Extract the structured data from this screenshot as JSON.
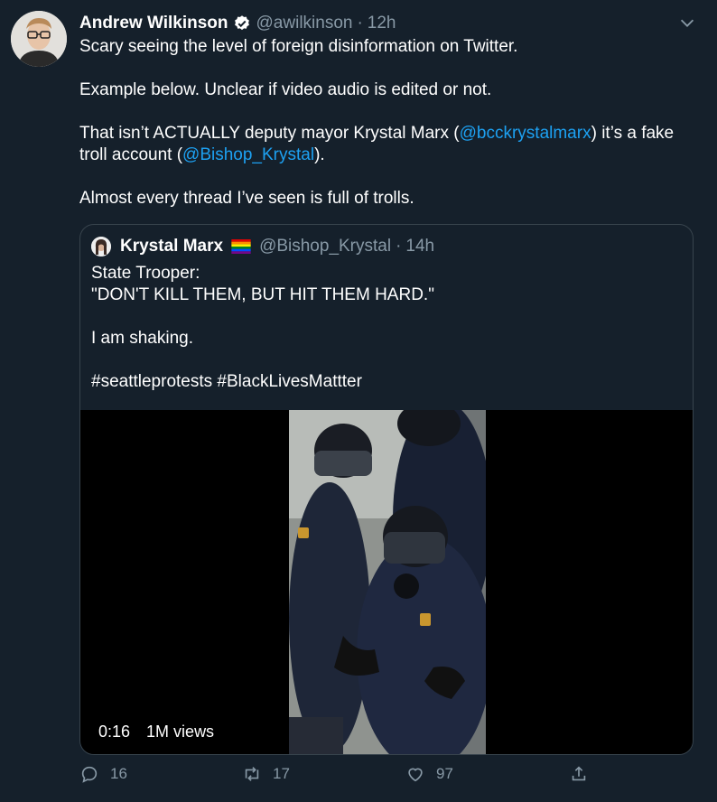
{
  "author": {
    "name": "Andrew Wilkinson",
    "handle": "@awilkinson",
    "separator": "·",
    "time": "12h"
  },
  "body": {
    "line1": "Scary seeing the level of foreign disinformation on Twitter.",
    "line2": "Example below. Unclear if video audio is edited or not.",
    "line3_a": "That isn’t ACTUALLY deputy mayor Krystal Marx (",
    "line3_link1": "@bcckrystalmarx",
    "line3_b": ") it’s a fake troll account (",
    "line3_link2": "@Bishop_Krystal",
    "line3_c": ").",
    "line4": "Almost every thread I’ve seen is full of trolls."
  },
  "quote": {
    "name": "Krystal Marx",
    "handle": "@Bishop_Krystal",
    "separator": "·",
    "time": "14h",
    "text1": "State Trooper:",
    "text2": "\"DON'T KILL THEM, BUT HIT THEM HARD.\"",
    "text3": "I am shaking.",
    "text4": "#seattleprotests #BlackLivesMattter",
    "video_time": "0:16",
    "video_views": "1M views"
  },
  "actions": {
    "replies": "16",
    "retweets": "17",
    "likes": "97"
  },
  "colors": {
    "background": "#15202b",
    "link": "#1da1f2",
    "secondary_text": "#8899a6",
    "border": "#38444d"
  },
  "icons": [
    "verified-badge-icon",
    "chevron-down-icon",
    "rainbow-flag-icon",
    "reply-icon",
    "retweet-icon",
    "like-icon",
    "share-icon"
  ]
}
